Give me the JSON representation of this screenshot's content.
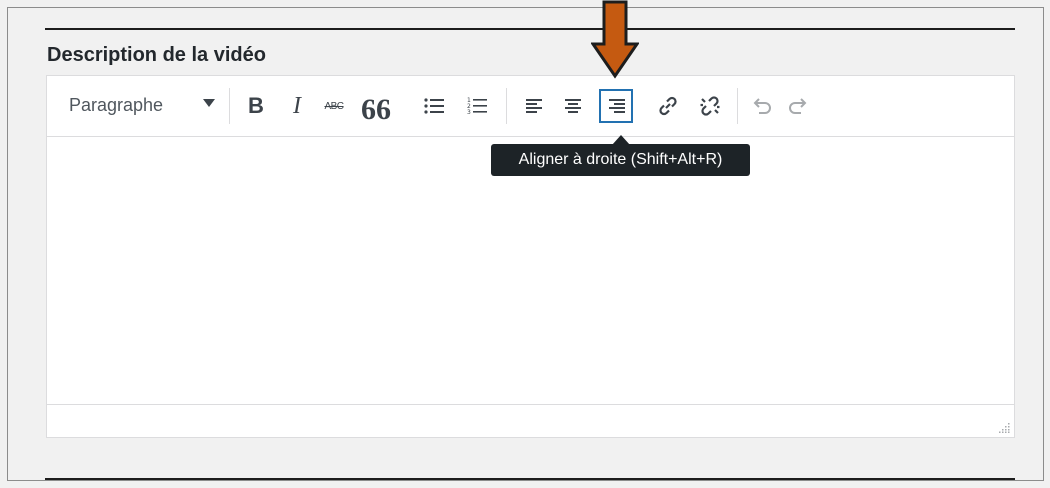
{
  "field": {
    "title": "Description de la vidéo"
  },
  "toolbar": {
    "format_label": "Paragraphe",
    "bold": "B",
    "italic": "I",
    "strike": "ABC",
    "quote": "66"
  },
  "tooltip": {
    "text": "Aligner à droite (Shift+Alt+R)"
  },
  "colors": {
    "annotation_arrow": "#c55a11",
    "active_outline": "#2271b1",
    "tooltip_bg": "#1d2327"
  },
  "icons": [
    "bullet-list-icon",
    "numbered-list-icon",
    "align-left-icon",
    "align-center-icon",
    "align-right-icon",
    "link-icon",
    "unlink-icon",
    "undo-icon",
    "redo-icon",
    "resize-grip-icon"
  ]
}
